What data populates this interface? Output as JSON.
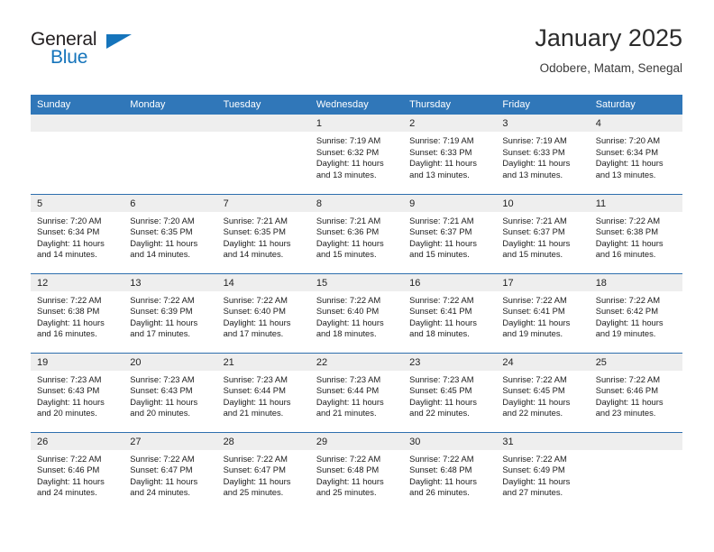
{
  "brand": {
    "name_part1": "General",
    "name_part2": "Blue",
    "triangle_icon": "triangle-icon",
    "accent_color": "#1574bb"
  },
  "header": {
    "title": "January 2025",
    "subtitle": "Odobere, Matam, Senegal"
  },
  "theme": {
    "header_bg": "#3077b9",
    "row_divider": "#2e6fae",
    "daynum_bg": "#eeeeee"
  },
  "weekdays": [
    "Sunday",
    "Monday",
    "Tuesday",
    "Wednesday",
    "Thursday",
    "Friday",
    "Saturday"
  ],
  "weeks": [
    [
      {
        "day": "",
        "sunrise": "",
        "sunset": "",
        "daylight1": "",
        "daylight2": "",
        "empty": true
      },
      {
        "day": "",
        "sunrise": "",
        "sunset": "",
        "daylight1": "",
        "daylight2": "",
        "empty": true
      },
      {
        "day": "",
        "sunrise": "",
        "sunset": "",
        "daylight1": "",
        "daylight2": "",
        "empty": true
      },
      {
        "day": "1",
        "sunrise": "Sunrise: 7:19 AM",
        "sunset": "Sunset: 6:32 PM",
        "daylight1": "Daylight: 11 hours",
        "daylight2": "and 13 minutes."
      },
      {
        "day": "2",
        "sunrise": "Sunrise: 7:19 AM",
        "sunset": "Sunset: 6:33 PM",
        "daylight1": "Daylight: 11 hours",
        "daylight2": "and 13 minutes."
      },
      {
        "day": "3",
        "sunrise": "Sunrise: 7:19 AM",
        "sunset": "Sunset: 6:33 PM",
        "daylight1": "Daylight: 11 hours",
        "daylight2": "and 13 minutes."
      },
      {
        "day": "4",
        "sunrise": "Sunrise: 7:20 AM",
        "sunset": "Sunset: 6:34 PM",
        "daylight1": "Daylight: 11 hours",
        "daylight2": "and 13 minutes."
      }
    ],
    [
      {
        "day": "5",
        "sunrise": "Sunrise: 7:20 AM",
        "sunset": "Sunset: 6:34 PM",
        "daylight1": "Daylight: 11 hours",
        "daylight2": "and 14 minutes."
      },
      {
        "day": "6",
        "sunrise": "Sunrise: 7:20 AM",
        "sunset": "Sunset: 6:35 PM",
        "daylight1": "Daylight: 11 hours",
        "daylight2": "and 14 minutes."
      },
      {
        "day": "7",
        "sunrise": "Sunrise: 7:21 AM",
        "sunset": "Sunset: 6:35 PM",
        "daylight1": "Daylight: 11 hours",
        "daylight2": "and 14 minutes."
      },
      {
        "day": "8",
        "sunrise": "Sunrise: 7:21 AM",
        "sunset": "Sunset: 6:36 PM",
        "daylight1": "Daylight: 11 hours",
        "daylight2": "and 15 minutes."
      },
      {
        "day": "9",
        "sunrise": "Sunrise: 7:21 AM",
        "sunset": "Sunset: 6:37 PM",
        "daylight1": "Daylight: 11 hours",
        "daylight2": "and 15 minutes."
      },
      {
        "day": "10",
        "sunrise": "Sunrise: 7:21 AM",
        "sunset": "Sunset: 6:37 PM",
        "daylight1": "Daylight: 11 hours",
        "daylight2": "and 15 minutes."
      },
      {
        "day": "11",
        "sunrise": "Sunrise: 7:22 AM",
        "sunset": "Sunset: 6:38 PM",
        "daylight1": "Daylight: 11 hours",
        "daylight2": "and 16 minutes."
      }
    ],
    [
      {
        "day": "12",
        "sunrise": "Sunrise: 7:22 AM",
        "sunset": "Sunset: 6:38 PM",
        "daylight1": "Daylight: 11 hours",
        "daylight2": "and 16 minutes."
      },
      {
        "day": "13",
        "sunrise": "Sunrise: 7:22 AM",
        "sunset": "Sunset: 6:39 PM",
        "daylight1": "Daylight: 11 hours",
        "daylight2": "and 17 minutes."
      },
      {
        "day": "14",
        "sunrise": "Sunrise: 7:22 AM",
        "sunset": "Sunset: 6:40 PM",
        "daylight1": "Daylight: 11 hours",
        "daylight2": "and 17 minutes."
      },
      {
        "day": "15",
        "sunrise": "Sunrise: 7:22 AM",
        "sunset": "Sunset: 6:40 PM",
        "daylight1": "Daylight: 11 hours",
        "daylight2": "and 18 minutes."
      },
      {
        "day": "16",
        "sunrise": "Sunrise: 7:22 AM",
        "sunset": "Sunset: 6:41 PM",
        "daylight1": "Daylight: 11 hours",
        "daylight2": "and 18 minutes."
      },
      {
        "day": "17",
        "sunrise": "Sunrise: 7:22 AM",
        "sunset": "Sunset: 6:41 PM",
        "daylight1": "Daylight: 11 hours",
        "daylight2": "and 19 minutes."
      },
      {
        "day": "18",
        "sunrise": "Sunrise: 7:22 AM",
        "sunset": "Sunset: 6:42 PM",
        "daylight1": "Daylight: 11 hours",
        "daylight2": "and 19 minutes."
      }
    ],
    [
      {
        "day": "19",
        "sunrise": "Sunrise: 7:23 AM",
        "sunset": "Sunset: 6:43 PM",
        "daylight1": "Daylight: 11 hours",
        "daylight2": "and 20 minutes."
      },
      {
        "day": "20",
        "sunrise": "Sunrise: 7:23 AM",
        "sunset": "Sunset: 6:43 PM",
        "daylight1": "Daylight: 11 hours",
        "daylight2": "and 20 minutes."
      },
      {
        "day": "21",
        "sunrise": "Sunrise: 7:23 AM",
        "sunset": "Sunset: 6:44 PM",
        "daylight1": "Daylight: 11 hours",
        "daylight2": "and 21 minutes."
      },
      {
        "day": "22",
        "sunrise": "Sunrise: 7:23 AM",
        "sunset": "Sunset: 6:44 PM",
        "daylight1": "Daylight: 11 hours",
        "daylight2": "and 21 minutes."
      },
      {
        "day": "23",
        "sunrise": "Sunrise: 7:23 AM",
        "sunset": "Sunset: 6:45 PM",
        "daylight1": "Daylight: 11 hours",
        "daylight2": "and 22 minutes."
      },
      {
        "day": "24",
        "sunrise": "Sunrise: 7:22 AM",
        "sunset": "Sunset: 6:45 PM",
        "daylight1": "Daylight: 11 hours",
        "daylight2": "and 22 minutes."
      },
      {
        "day": "25",
        "sunrise": "Sunrise: 7:22 AM",
        "sunset": "Sunset: 6:46 PM",
        "daylight1": "Daylight: 11 hours",
        "daylight2": "and 23 minutes."
      }
    ],
    [
      {
        "day": "26",
        "sunrise": "Sunrise: 7:22 AM",
        "sunset": "Sunset: 6:46 PM",
        "daylight1": "Daylight: 11 hours",
        "daylight2": "and 24 minutes."
      },
      {
        "day": "27",
        "sunrise": "Sunrise: 7:22 AM",
        "sunset": "Sunset: 6:47 PM",
        "daylight1": "Daylight: 11 hours",
        "daylight2": "and 24 minutes."
      },
      {
        "day": "28",
        "sunrise": "Sunrise: 7:22 AM",
        "sunset": "Sunset: 6:47 PM",
        "daylight1": "Daylight: 11 hours",
        "daylight2": "and 25 minutes."
      },
      {
        "day": "29",
        "sunrise": "Sunrise: 7:22 AM",
        "sunset": "Sunset: 6:48 PM",
        "daylight1": "Daylight: 11 hours",
        "daylight2": "and 25 minutes."
      },
      {
        "day": "30",
        "sunrise": "Sunrise: 7:22 AM",
        "sunset": "Sunset: 6:48 PM",
        "daylight1": "Daylight: 11 hours",
        "daylight2": "and 26 minutes."
      },
      {
        "day": "31",
        "sunrise": "Sunrise: 7:22 AM",
        "sunset": "Sunset: 6:49 PM",
        "daylight1": "Daylight: 11 hours",
        "daylight2": "and 27 minutes."
      },
      {
        "day": "",
        "sunrise": "",
        "sunset": "",
        "daylight1": "",
        "daylight2": "",
        "empty": true
      }
    ]
  ]
}
